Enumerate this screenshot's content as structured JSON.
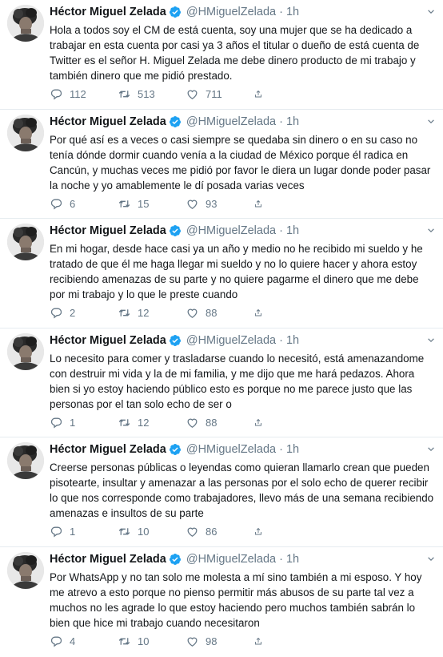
{
  "author": {
    "name": "Héctor Miguel Zelada",
    "handle": "@HMiguelZelada",
    "separator": "·"
  },
  "icons": {
    "verified": "verified-badge-icon",
    "caret": "chevron-down-icon",
    "reply": "reply-icon",
    "retweet": "retweet-icon",
    "like": "heart-icon",
    "share": "share-icon"
  },
  "colors": {
    "verified": "#1da1f2",
    "muted": "#657786",
    "divider": "#e6ecf0"
  },
  "tweets": [
    {
      "time": "1h",
      "text": "Hola a todos soy el CM de está cuenta, soy una mujer que se ha dedicado a trabajar en esta cuenta por casi ya 3 años el titular o dueño de está cuenta de Twitter es el señor H. Miguel Zelada me debe dinero producto de mi trabajo y también dinero que me pidió prestado.",
      "replies": "112",
      "retweets": "513",
      "likes": "711"
    },
    {
      "time": "1h",
      "text": "Por qué así es a veces o casi siempre se quedaba sin dinero o en su caso no tenía dónde dormir cuando venía a la ciudad de México porque él radica en Cancún, y muchas veces me pidió por favor le diera un lugar donde poder pasar la noche y yo amablemente le dí posada varias veces",
      "replies": "6",
      "retweets": "15",
      "likes": "93"
    },
    {
      "time": "1h",
      "text": "En mi hogar, desde hace casi ya un año y medio no he recibido mi sueldo y he tratado de que él me haga llegar mi sueldo y no lo quiere hacer y ahora estoy recibiendo amenazas de su parte y no quiere pagarme el dinero que me debe por mi trabajo y lo que le preste cuando",
      "replies": "2",
      "retweets": "12",
      "likes": "88"
    },
    {
      "time": "1h",
      "text": "Lo necesito para comer y trasladarse cuando lo necesitó, está amenazandome con destruir mi vida y la de mi familia, y me dijo que me hará pedazos. Ahora bien si yo estoy haciendo público esto es porque no me parece justo que las personas por el tan solo echo de ser o",
      "replies": "1",
      "retweets": "12",
      "likes": "88"
    },
    {
      "time": "1h",
      "text": "Creerse personas públicas o leyendas como quieran llamarlo crean que pueden pisotearte, insultar y amenazar a las personas por el solo echo de querer recibir lo que nos corresponde como trabajadores, llevo más de una semana recibiendo amenazas e insultos de su parte",
      "replies": "1",
      "retweets": "10",
      "likes": "86"
    },
    {
      "time": "1h",
      "text": "Por WhatsApp y no tan solo me molesta a mí sino también a mi esposo. Y hoy me atrevo a esto porque no pienso permitir más abusos de su parte tal vez a muchos no les agrade lo que estoy haciendo pero muchos también sabrán lo bien que hice mi trabajo cuando necesitaron",
      "replies": "4",
      "retweets": "10",
      "likes": "98"
    }
  ]
}
